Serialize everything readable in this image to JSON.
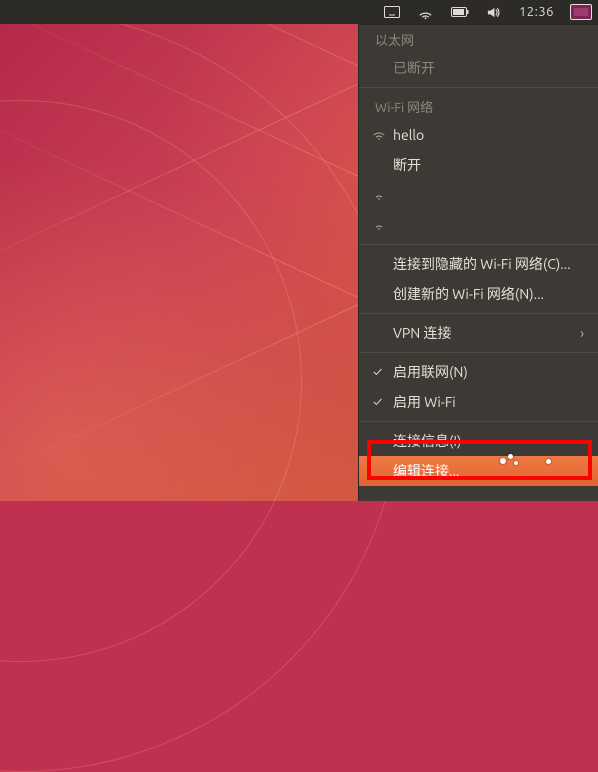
{
  "topbar": {
    "time": "12:36"
  },
  "menu": {
    "ethernet_header": "以太网",
    "ethernet_disconnected": "已断开",
    "wifi_header": "Wi-Fi 网络",
    "wifi_network_1": "hello",
    "wifi_disconnect": "断开",
    "connect_hidden": "连接到隐藏的 Wi-Fi 网络(C)...",
    "create_new": "创建新的 Wi-Fi 网络(N)...",
    "vpn": "VPN 连接",
    "enable_networking": "启用联网(N)",
    "enable_wifi": "启用 Wi-Fi",
    "connection_info": "连接信息(I)",
    "edit_connections": "编辑连接..."
  }
}
